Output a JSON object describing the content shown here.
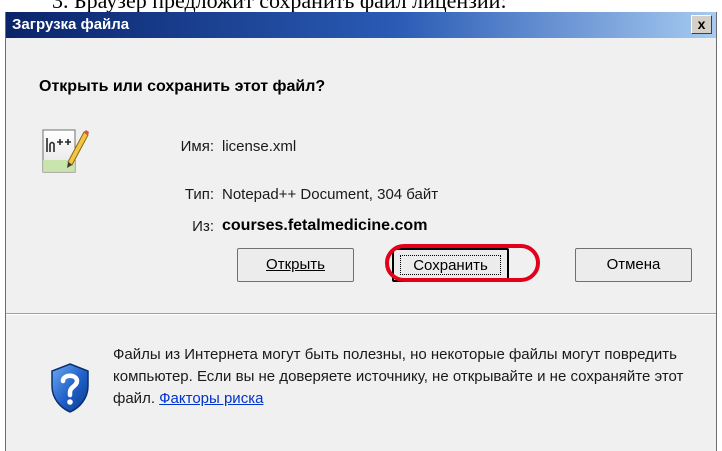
{
  "document": {
    "caption": "3.  Браузер предложит сохранить файл лицензии:"
  },
  "dialog": {
    "title": "Загрузка файла",
    "close_glyph": "x",
    "question": "Открыть или сохранить этот файл?",
    "file_icon": "notepad-plus-plus-document-icon",
    "name_label": "Имя:",
    "name_value": "license.xml",
    "type_label": "Тип:",
    "type_value": "Notepad++ Document, 304 байт",
    "from_label": "Из:",
    "from_value": "courses.fetalmedicine.com",
    "buttons": {
      "open": "Открыть",
      "save": "Сохранить",
      "cancel": "Отмена"
    },
    "security_icon": "shield-question-icon",
    "warning_text": "Файлы из Интернета могут быть полезны, но некоторые файлы могут повредить компьютер. Если вы не доверяете источнику, не открывайте и не сохраняйте этот файл.",
    "risk_link": "Факторы риска"
  },
  "annotation": {
    "highlight_color": "#e3001b"
  }
}
